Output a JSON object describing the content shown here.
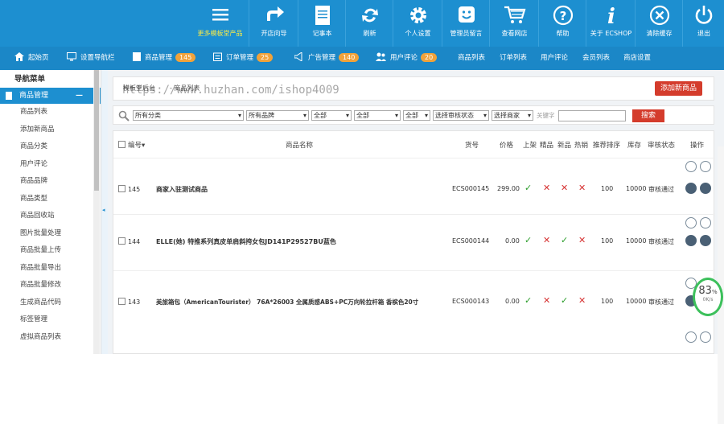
{
  "topbar": {
    "brand_label": "更多模板堂产品",
    "buttons": [
      {
        "label": "开店向导",
        "icon": "arrow-forward-icon"
      },
      {
        "label": "记事本",
        "icon": "notepad-icon"
      },
      {
        "label": "刷新",
        "icon": "refresh-icon"
      },
      {
        "label": "个人设置",
        "icon": "gear-icon"
      },
      {
        "label": "管理员留言",
        "icon": "message-smile-icon"
      },
      {
        "label": "查看网店",
        "icon": "cart-icon"
      },
      {
        "label": "帮助",
        "icon": "help-icon"
      },
      {
        "label": "关于 ECSHOP",
        "icon": "info-icon"
      },
      {
        "label": "清除缓存",
        "icon": "clear-icon"
      },
      {
        "label": "退出",
        "icon": "power-icon"
      }
    ]
  },
  "navbar": {
    "home": "起始页",
    "set_nav": "设置导航栏",
    "goods_manage": "商品管理",
    "goods_badge": "145",
    "order_manage": "订单管理",
    "order_badge": "25",
    "ad_manage": "广告管理",
    "ad_badge": "140",
    "user_comment": "用户评论",
    "comment_badge": "20",
    "links": [
      "商品列表",
      "订单列表",
      "用户评论",
      "会员列表",
      "商店设置"
    ]
  },
  "sidebar": {
    "title": "导航菜单",
    "group": "商品管理",
    "group_toggle": "—",
    "items": [
      "商品列表",
      "添加新商品",
      "商品分类",
      "用户评论",
      "商品品牌",
      "商品类型",
      "商品回收站",
      "图片批量处理",
      "商品批量上传",
      "商品批量导出",
      "商品批量修改",
      "生成商品代码",
      "标签管理",
      "虚拟商品列表"
    ]
  },
  "main": {
    "breadcrumb_root": "模板堂后台",
    "breadcrumb_current": "- 商品列表",
    "add_button": "添加新商品",
    "filters": [
      "所有分类",
      "所有品牌",
      "全部",
      "全部",
      "全部",
      "选择审核状态",
      "选择商家"
    ],
    "keyword_label": "关键字",
    "search_button": "搜索",
    "columns": {
      "id": "编号",
      "name": "商品名称",
      "sn": "货号",
      "price": "价格",
      "on_sale": "上架",
      "best": "精品",
      "new": "新品",
      "hot": "热销",
      "sort": "推荐排序",
      "stock": "库存",
      "review": "审核状态",
      "action": "操作"
    },
    "rows": [
      {
        "id": "145",
        "name": "商家入驻测试商品",
        "sn": "ECS000145",
        "price": "299.00",
        "flags": [
          "ok",
          "no",
          "no",
          "no"
        ],
        "sort": "100",
        "stock": "10000",
        "review": "审核通过"
      },
      {
        "id": "144",
        "name": "ELLE(她) 特推系列真皮单肩斜挎女包JD141P29527BU蓝色",
        "sn": "ECS000144",
        "price": "0.00",
        "flags": [
          "ok",
          "no",
          "ok",
          "no"
        ],
        "sort": "100",
        "stock": "10000",
        "review": "审核通过"
      },
      {
        "id": "143",
        "name": "美旅箱包（AmericanTourister） 76A*26003 全属质感ABS+PC万向轮拉杆箱 香槟色20寸",
        "sn": "ECS000143",
        "price": "0.00",
        "flags": [
          "ok",
          "no",
          "ok",
          "no"
        ],
        "sort": "100",
        "stock": "10000",
        "review": "审核通过"
      }
    ]
  },
  "watermark": "https://www.huzhan.com/ishop4009",
  "speed_widget": {
    "percent": "83",
    "unit": "%",
    "rate": "0K/s"
  }
}
